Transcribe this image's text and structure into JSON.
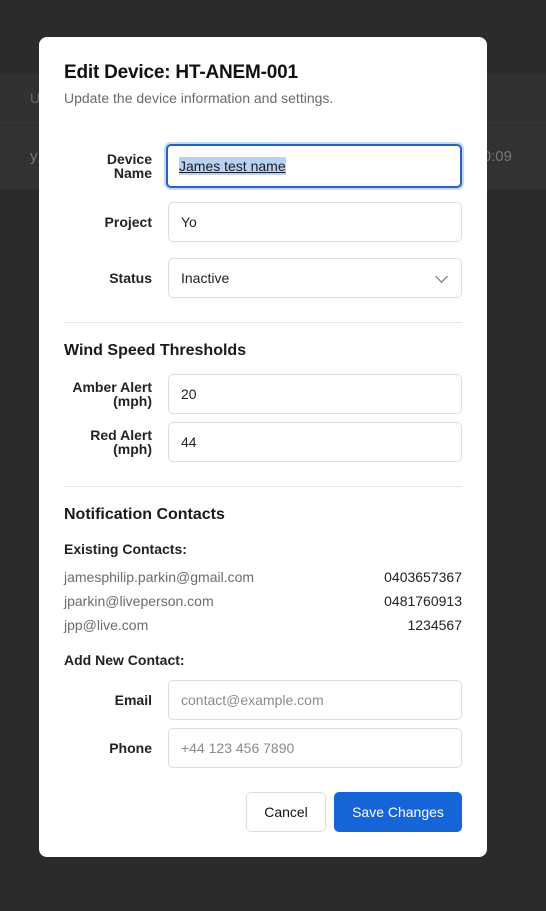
{
  "background": {
    "header_text": "U",
    "row_left": "y",
    "row_right": "0:09"
  },
  "dialog": {
    "title": "Edit Device: HT-ANEM-001",
    "subtitle": "Update the device information and settings.",
    "fields": {
      "device_name": {
        "label_line1": "Device",
        "label_line2": "Name",
        "value": "James test name"
      },
      "project": {
        "label": "Project",
        "value": "Yo"
      },
      "status": {
        "label": "Status",
        "value": "Inactive"
      }
    },
    "thresholds": {
      "title": "Wind Speed Thresholds",
      "amber": {
        "label_line1": "Amber Alert",
        "label_line2": "(mph)",
        "value": "20"
      },
      "red": {
        "label_line1": "Red Alert",
        "label_line2": "(mph)",
        "value": "44"
      }
    },
    "contacts": {
      "title": "Notification Contacts",
      "existing_heading": "Existing Contacts:",
      "existing": [
        {
          "email": "jamesphilip.parkin@gmail.com",
          "phone": "0403657367"
        },
        {
          "email": "jparkin@liveperson.com",
          "phone": "0481760913"
        },
        {
          "email": "jpp@live.com",
          "phone": "1234567"
        }
      ],
      "add_heading": "Add New Contact:",
      "email": {
        "label": "Email",
        "placeholder": "contact@example.com"
      },
      "phone": {
        "label": "Phone",
        "placeholder": "+44 123 456 7890"
      }
    },
    "buttons": {
      "cancel": "Cancel",
      "save": "Save Changes"
    }
  },
  "colors": {
    "accent": "#1565d8",
    "overlay": "#2b2b2b"
  }
}
